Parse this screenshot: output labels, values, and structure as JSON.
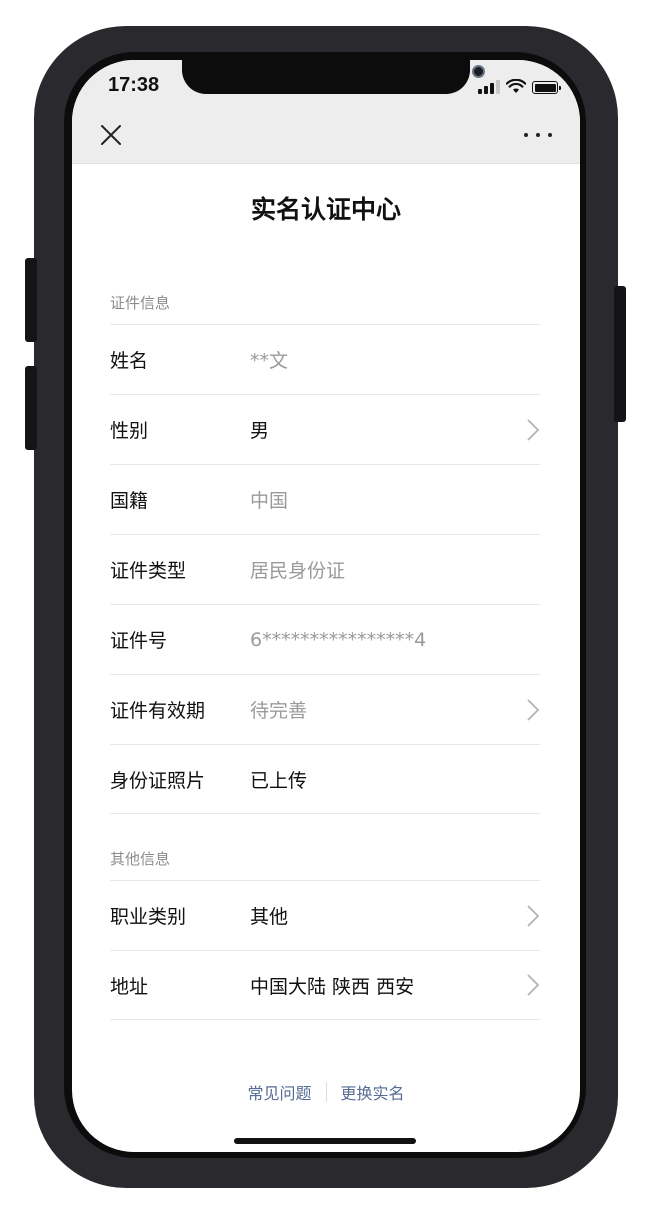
{
  "status_bar": {
    "time": "17:38",
    "icons": [
      "signal-icon",
      "wifi-icon",
      "battery-icon"
    ]
  },
  "nav": {
    "close_icon": "close-icon",
    "more_icon": "more-dots-icon"
  },
  "page": {
    "title": "实名认证中心"
  },
  "sections": {
    "id_info": {
      "label": "证件信息",
      "rows": [
        {
          "label": "姓名",
          "value": "**文",
          "muted": true,
          "chevron": false
        },
        {
          "label": "性别",
          "value": "男",
          "muted": false,
          "chevron": true
        },
        {
          "label": "国籍",
          "value": "中国",
          "muted": true,
          "chevron": false
        },
        {
          "label": "证件类型",
          "value": "居民身份证",
          "muted": true,
          "chevron": false
        },
        {
          "label": "证件号",
          "value": "6****************4",
          "muted": true,
          "chevron": false
        },
        {
          "label": "证件有效期",
          "value": "待完善",
          "muted": true,
          "chevron": true
        },
        {
          "label": "身份证照片",
          "value": "已上传",
          "muted": false,
          "chevron": false
        }
      ]
    },
    "other_info": {
      "label": "其他信息",
      "rows": [
        {
          "label": "职业类别",
          "value": "其他",
          "muted": false,
          "chevron": true
        },
        {
          "label": "地址",
          "value": "中国大陆 陕西 西安",
          "muted": false,
          "chevron": true
        }
      ]
    }
  },
  "footer": {
    "faq": "常见问题",
    "change_name": "更换实名"
  },
  "colors": {
    "link": "#576b95",
    "muted_text": "#9a9a9a",
    "topbar_bg": "#ededed"
  }
}
